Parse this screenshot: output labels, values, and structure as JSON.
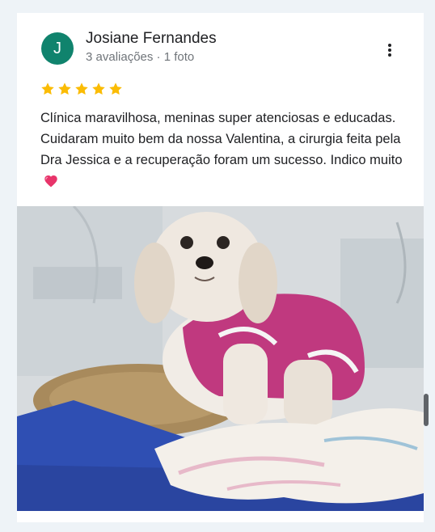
{
  "review": {
    "avatar_letter": "J",
    "reviewer_name": "Josiane Fernandes",
    "reviewer_meta": "3 avaliações · 1 foto",
    "rating": 5,
    "text": "Clínica maravilhosa, meninas super atenciosas e educadas. Cuidaram muito bem da nossa  Valentina, a cirurgia feita pela Dra Jessica e a recuperação foram um sucesso. Indico muito",
    "more_icon": "more-vert-icon",
    "heart_icon": "heart-emoji-icon"
  },
  "colors": {
    "avatar_bg": "#10836d",
    "star": "#fbbc04",
    "heart": "#e8346a"
  }
}
